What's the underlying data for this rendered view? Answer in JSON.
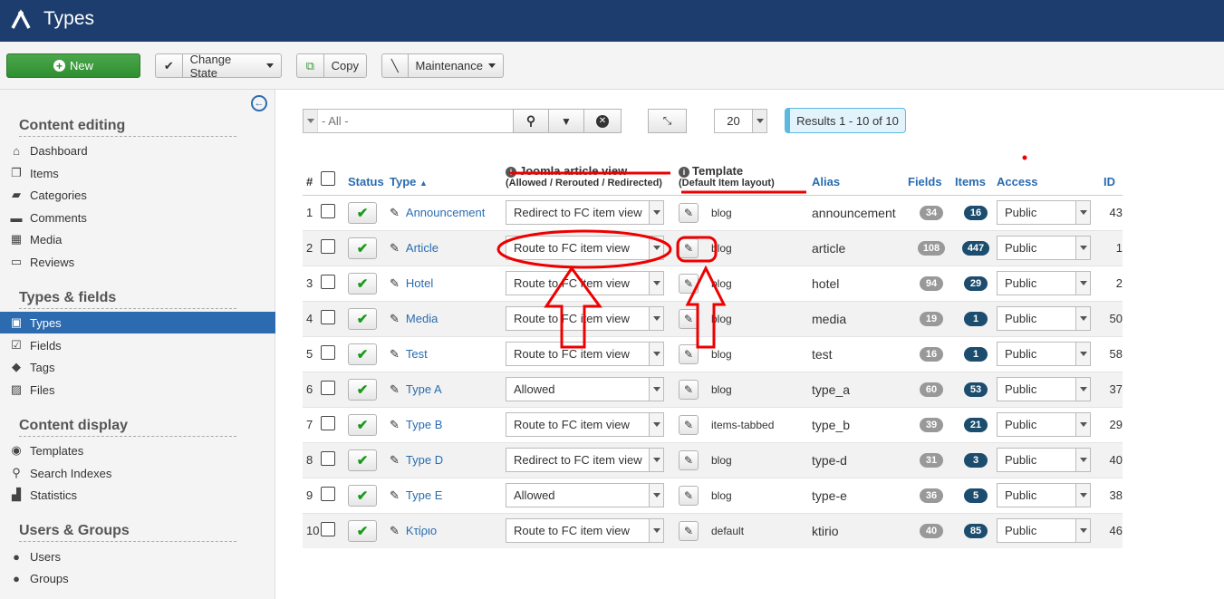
{
  "header": {
    "title": "Types"
  },
  "toolbar": {
    "new_label": "New",
    "change_state_label": "Change State",
    "copy_label": "Copy",
    "maintenance_label": "Maintenance"
  },
  "sidebar": {
    "sections": [
      {
        "title": "Content editing",
        "items": [
          "Dashboard",
          "Items",
          "Categories",
          "Comments",
          "Media",
          "Reviews"
        ]
      },
      {
        "title": "Types & fields",
        "items": [
          "Types",
          "Fields",
          "Tags",
          "Files"
        ]
      },
      {
        "title": "Content display",
        "items": [
          "Templates",
          "Search Indexes",
          "Statistics"
        ]
      },
      {
        "title": "Users & Groups",
        "items": [
          "Users",
          "Groups"
        ]
      }
    ],
    "active_item": "Types"
  },
  "filters": {
    "search_placeholder": "- All -",
    "limit_value": "20",
    "results_text": "Results 1 - 10 of 10"
  },
  "table": {
    "headers": {
      "num": "#",
      "status": "Status",
      "type": "Type",
      "jview": "Joomla article view",
      "jview_sub": "(Allowed / Rerouted / Redirected)",
      "template": "Template",
      "template_sub": "(Default Item layout)",
      "alias": "Alias",
      "fields": "Fields",
      "items": "Items",
      "access": "Access",
      "id": "ID"
    },
    "rows": [
      {
        "num": "1",
        "type": "Announcement",
        "view": "Redirect to FC item view",
        "template": "blog",
        "alias": "announcement",
        "fields": "34",
        "items": "16",
        "access": "Public",
        "id": "43"
      },
      {
        "num": "2",
        "type": "Article",
        "view": "Route to FC item view",
        "template": "blog",
        "alias": "article",
        "fields": "108",
        "items": "447",
        "access": "Public",
        "id": "1"
      },
      {
        "num": "3",
        "type": "Hotel",
        "view": "Route to FC item view",
        "template": "blog",
        "alias": "hotel",
        "fields": "94",
        "items": "29",
        "access": "Public",
        "id": "2"
      },
      {
        "num": "4",
        "type": "Media",
        "view": "Route to FC item view",
        "template": "blog",
        "alias": "media",
        "fields": "19",
        "items": "1",
        "access": "Public",
        "id": "50"
      },
      {
        "num": "5",
        "type": "Test",
        "view": "Route to FC item view",
        "template": "blog",
        "alias": "test",
        "fields": "16",
        "items": "1",
        "access": "Public",
        "id": "58"
      },
      {
        "num": "6",
        "type": "Type A",
        "view": "Allowed",
        "template": "blog",
        "alias": "type_a",
        "fields": "60",
        "items": "53",
        "access": "Public",
        "id": "37"
      },
      {
        "num": "7",
        "type": "Type B",
        "view": "Route to FC item view",
        "template": "items-tabbed",
        "alias": "type_b",
        "fields": "39",
        "items": "21",
        "access": "Public",
        "id": "29"
      },
      {
        "num": "8",
        "type": "Type D",
        "view": "Redirect to FC item view",
        "template": "blog",
        "alias": "type-d",
        "fields": "31",
        "items": "3",
        "access": "Public",
        "id": "40"
      },
      {
        "num": "9",
        "type": "Type E",
        "view": "Allowed",
        "template": "blog",
        "alias": "type-e",
        "fields": "36",
        "items": "5",
        "access": "Public",
        "id": "38"
      },
      {
        "num": "10",
        "type": "Κτίριο",
        "view": "Route to FC item view",
        "template": "default",
        "alias": "ktirio",
        "fields": "40",
        "items": "85",
        "access": "Public",
        "id": "46"
      }
    ]
  },
  "colors": {
    "header_bg": "#1c3d6e",
    "accent": "#2d6bb0",
    "new_button": "#3a9b3a",
    "annotation": "#e00000",
    "badge_items": "#1c4d6e",
    "badge_fields": "#999999"
  }
}
